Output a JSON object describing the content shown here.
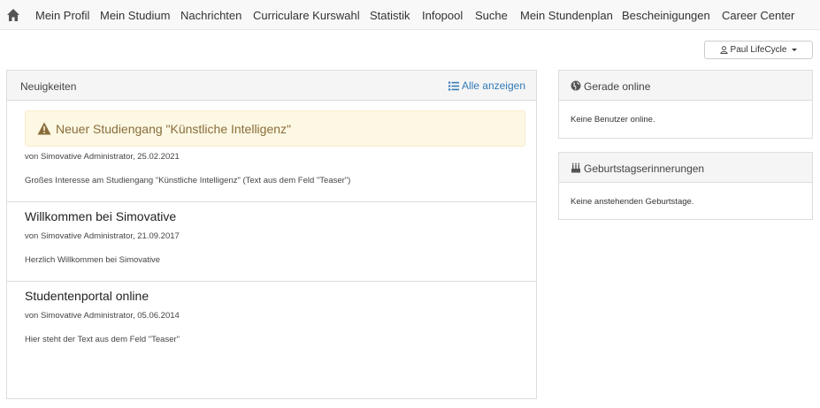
{
  "nav": {
    "items": [
      {
        "label": "Mein Profil"
      },
      {
        "label": "Mein Studium"
      },
      {
        "label": "Nachrichten"
      },
      {
        "label": "Curriculare Kurswahl"
      },
      {
        "label": "Statistik"
      },
      {
        "label": "Infopool"
      },
      {
        "label": "Suche"
      },
      {
        "label": "Mein Stundenplan"
      },
      {
        "label": "Bescheinigungen"
      },
      {
        "label": "Career Center"
      }
    ],
    "home_icon": "home-icon"
  },
  "user_menu": {
    "label": "Paul LifeCycle",
    "icon": "user-icon"
  },
  "news": {
    "heading": "Neuigkeiten",
    "all_link": "Alle anzeigen",
    "items": [
      {
        "title": "Neuer Studiengang \"Künstliche Intelligenz\"",
        "meta": "von Simovative Administrator, 25.02.2021",
        "teaser": "Großes Interesse am Studiengang \"Künstliche Intelligenz\" (Text aus dem Feld \"Teaser\")"
      },
      {
        "title": "Willkommen bei Simovative",
        "meta": "von Simovative Administrator, 21.09.2017",
        "teaser": "Herzlich Willkommen bei Simovative"
      },
      {
        "title": "Studentenportal online",
        "meta": "von Simovative Administrator, 05.06.2014",
        "teaser": "Hier steht der Text aus dem Feld \"Teaser\""
      }
    ]
  },
  "online": {
    "heading": "Gerade online",
    "text": "Keine Benutzer online.",
    "icon": "globe-icon"
  },
  "birthdays": {
    "heading": "Geburtstagserinnerungen",
    "text": "Keine anstehenden Geburtstage.",
    "icon": "cake-icon"
  },
  "colors": {
    "link": "#337ab7",
    "alert_bg": "#fcf8e3",
    "alert_text": "#8a6d3b"
  }
}
